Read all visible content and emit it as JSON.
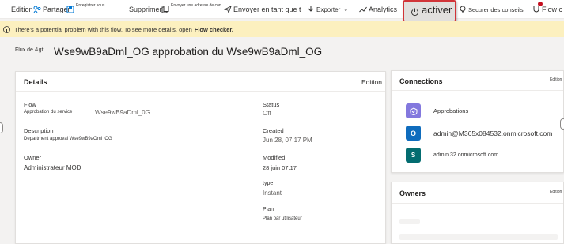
{
  "toolbar": {
    "edit": "Edition",
    "share": "Partager",
    "save_as": "Enregistrer sous",
    "delete": "Supprimer",
    "send_copy_email": "Envoyer une adresse de con",
    "send_copy": "Envoyer en tant que t",
    "export": "Exporter",
    "analytics": "Analytics",
    "activate": "activer",
    "secure": "Securer des conseils",
    "flow_checker": "Flow c"
  },
  "banner": {
    "message": "There's a potential problem with this flow. To see more details, open",
    "link": "Flow checker."
  },
  "page": {
    "flow_of_label": "Flux de &gt;",
    "title": "Wse9wB9aDml_OG approbation du Wse9wB9aDml_OG"
  },
  "details": {
    "title": "Details",
    "edit": "Edition",
    "flow_label": "Flow",
    "flow_value_prefix": "Approbation du service",
    "flow_value_name": "Wse9wB9aDml_0G",
    "description_label": "Description",
    "description_value": "Department approval Wse9wB9aOml_OG",
    "owner_label": "Owner",
    "owner_value": "Administrateur MOD",
    "status_label": "Status",
    "status_value": "Off",
    "created_label": "Created",
    "created_value": "Jun 28, 07:17 PM",
    "modified_label": "Modified",
    "modified_value": "28 juin 07:17",
    "type_label": "type",
    "type_value": "Instant",
    "plan_label": "Plan",
    "plan_value": "Plan par utilisateur"
  },
  "connections": {
    "title": "Connections",
    "edit": "Edition",
    "items": [
      {
        "label": "Approbations",
        "icon": "approvals-icon",
        "color": "#8378de"
      },
      {
        "label": "admin@M365x084532.onmicrosoft.com",
        "icon": "outlook-icon",
        "color": "#0f6cbd"
      },
      {
        "label": "admin 32.onmicrosoft.com",
        "icon": "sharepoint-icon",
        "color": "#036c70"
      }
    ]
  },
  "owners": {
    "title": "Owners",
    "edit": "Edition"
  },
  "colors": {
    "banner_bg": "#fcf0bf",
    "highlight_border": "#d13438",
    "notification_dot": "#c50f1f"
  }
}
